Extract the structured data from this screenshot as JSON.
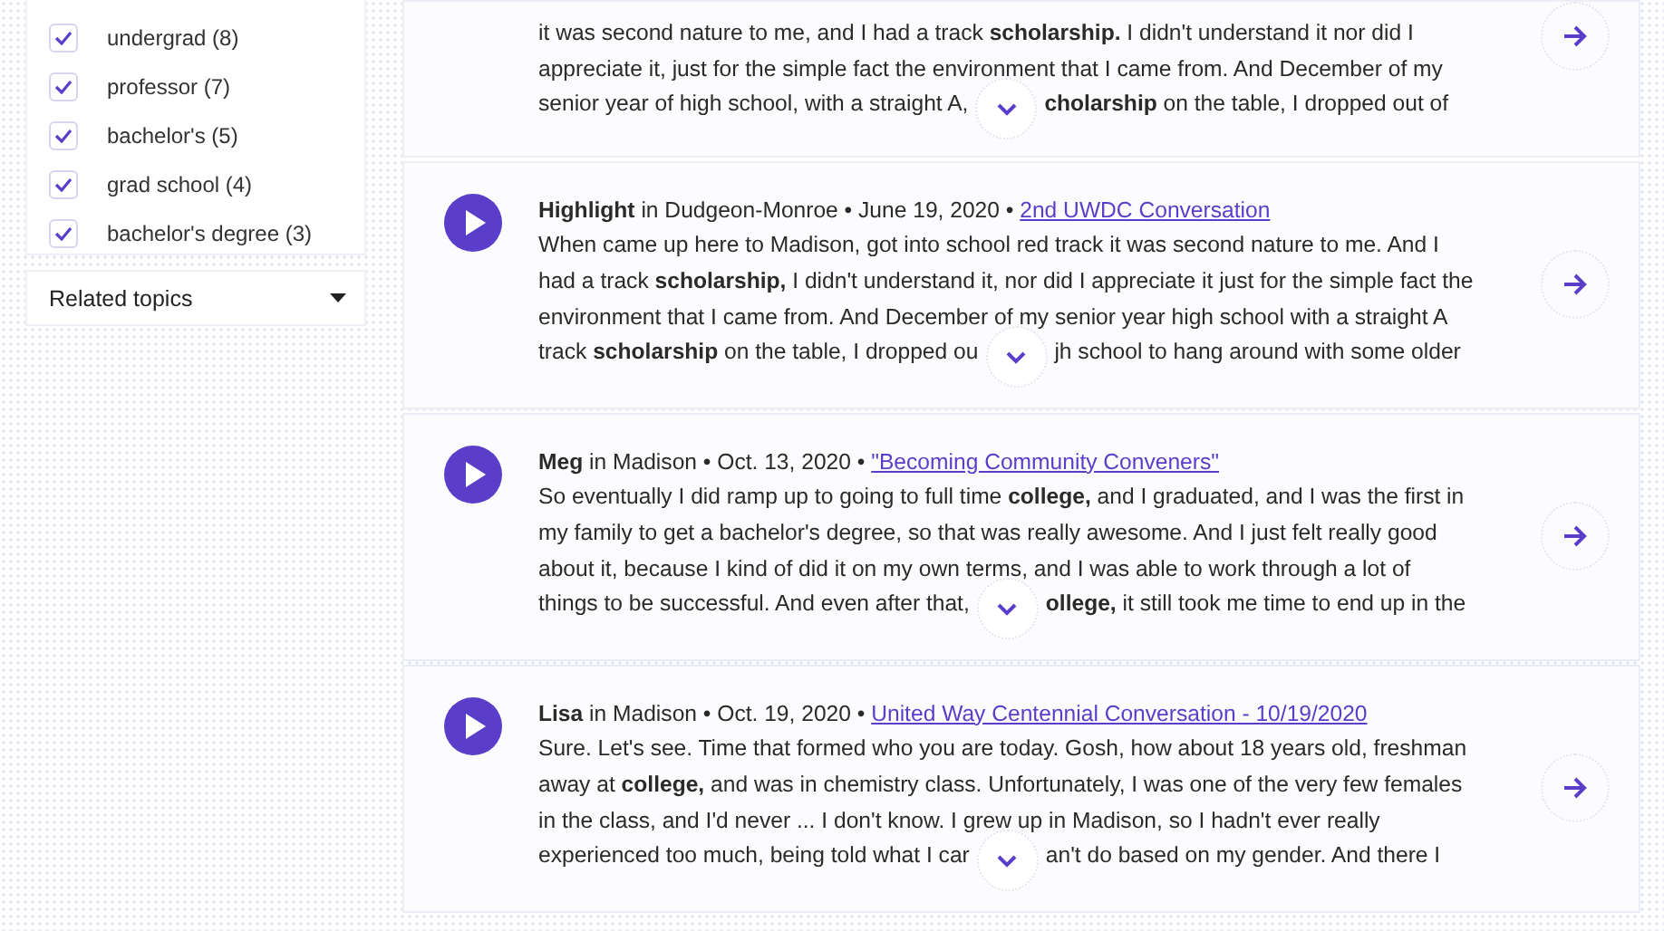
{
  "filters": [
    {
      "label": "undergrad (8)",
      "checked": true
    },
    {
      "label": "professor (7)",
      "checked": true
    },
    {
      "label": "bachelor's (5)",
      "checked": true
    },
    {
      "label": "grad school (4)",
      "checked": true
    },
    {
      "label": "bachelor's degree (3)",
      "checked": true
    }
  ],
  "related_topics": {
    "label": "Related topics",
    "expanded": false
  },
  "stories": [
    {
      "lines": [
        "it was second nature to me, and I had a track **scholarship.** I didn't understand it nor did I",
        "appreciate it, just for the simple fact the environment that I came from. And December of my"
      ],
      "last_left": "senior year of high school, with a straight A,",
      "last_right": "**cholarship** on the table, I dropped out of"
    },
    {
      "byline": "**Highlight** in Dudgeon-Monroe • June 19, 2020 •",
      "conversation": "2nd UWDC Conversation",
      "lines": [
        "When came up here to Madison, got into school red track it was second nature to me. And I",
        "had a track **scholarship,** I didn't understand it, nor did I appreciate it just for the simple fact the",
        "environment that I came from. And December of my senior year high school with a straight A"
      ],
      "last_left": "track **scholarship** on the table, I dropped ou",
      "last_right": "jh school to hang around with some older"
    },
    {
      "byline": "**Meg** in Madison • Oct. 13, 2020 •",
      "conversation": "\"Becoming Community Conveners\"",
      "lines": [
        "So eventually I did ramp up to going to full time **college,** and I graduated, and I was the first in",
        "my family to get a bachelor's degree, so that was really awesome. And I just felt really good",
        "about it, because I kind of did it on my own terms, and I was able to work through a lot of"
      ],
      "last_left": "things to be successful. And even after that,",
      "last_right": "**ollege,** it still took me time to end up in the"
    },
    {
      "byline": "**Lisa** in Madison • Oct. 19, 2020 •",
      "conversation": "United Way Centennial Conversation - 10/19/2020",
      "lines": [
        "Sure. Let's see. Time that formed who you are today. Gosh, how about 18 years old, freshman",
        "away at **college,** and was in chemistry class. Unfortunately, I was one of the very few females",
        "in the class, and I'd never ... I don't know. I grew up in Madison, so I hadn't ever really"
      ],
      "last_left": "experienced too much, being told what I car",
      "last_right": "an't do based on my gender. And there I"
    }
  ]
}
